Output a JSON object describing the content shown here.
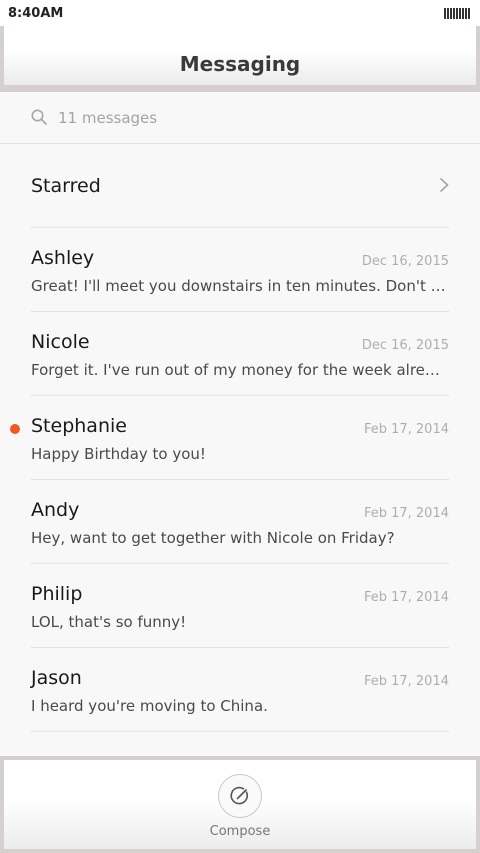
{
  "status_bar": {
    "time": "8:40AM"
  },
  "header": {
    "title": "Messaging"
  },
  "search": {
    "placeholder": "11 messages"
  },
  "starred": {
    "label": "Starred"
  },
  "conversations": [
    {
      "name": "Ashley",
      "date": "Dec 16, 2015",
      "preview": "Great! I'll meet you downstairs in ten minutes. Don't forget your umbrella.",
      "unread": false
    },
    {
      "name": "Nicole",
      "date": "Dec 16, 2015",
      "preview": "Forget it. I've run out of my money for the week already.",
      "unread": false
    },
    {
      "name": "Stephanie",
      "date": "Feb 17, 2014",
      "preview": "Happy Birthday to you!",
      "unread": true
    },
    {
      "name": "Andy",
      "date": "Feb 17, 2014",
      "preview": "Hey, want to get together with Nicole on Friday?",
      "unread": false
    },
    {
      "name": "Philip",
      "date": "Feb 17, 2014",
      "preview": "LOL, that's so funny!",
      "unread": false
    },
    {
      "name": "Jason",
      "date": "Feb 17, 2014",
      "preview": "I heard you're moving to China.",
      "unread": false
    }
  ],
  "bottom_bar": {
    "compose_label": "Compose"
  },
  "colors": {
    "unread_accent": "#f05a20",
    "background": "#f8f8f8",
    "divider": "#e2e2e2"
  }
}
